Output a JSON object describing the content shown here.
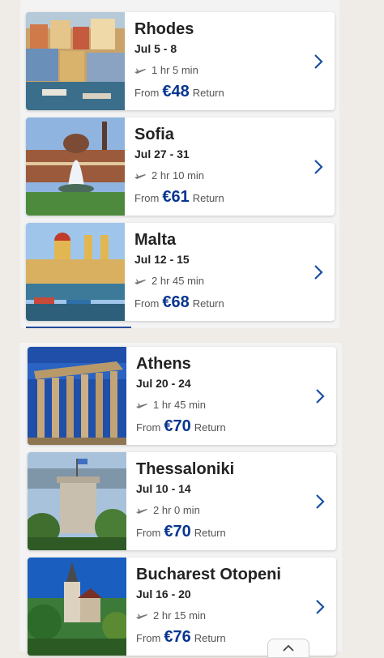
{
  "groups": [
    {
      "destinations": [
        {
          "city": "Rhodes",
          "dates": "Jul 5 - 8",
          "duration": "1 hr 5 min",
          "from_label": "From",
          "price": "€48",
          "trip_label": "Return",
          "image_icon": "harbor-photo"
        },
        {
          "city": "Sofia",
          "dates": "Jul 27 - 31",
          "duration": "2 hr 10 min",
          "from_label": "From",
          "price": "€61",
          "trip_label": "Return",
          "image_icon": "fountain-photo"
        },
        {
          "city": "Malta",
          "dates": "Jul 12 - 15",
          "duration": "2 hr 45 min",
          "from_label": "From",
          "price": "€68",
          "trip_label": "Return",
          "image_icon": "church-harbor-photo"
        }
      ]
    },
    {
      "destinations": [
        {
          "city": "Athens",
          "dates": "Jul 20 - 24",
          "duration": "1 hr 45 min",
          "from_label": "From",
          "price": "€70",
          "trip_label": "Return",
          "image_icon": "parthenon-photo"
        },
        {
          "city": "Thessaloniki",
          "dates": "Jul 10 - 14",
          "duration": "2 hr 0 min",
          "from_label": "From",
          "price": "€70",
          "trip_label": "Return",
          "image_icon": "white-tower-photo"
        },
        {
          "city": "Bucharest Otopeni",
          "dates": "Jul 16 - 20",
          "duration": "2 hr 15 min",
          "from_label": "From",
          "price": "€76",
          "trip_label": "Return",
          "image_icon": "castle-photo"
        }
      ]
    }
  ],
  "colors": {
    "price": "#073590",
    "chevron": "#1a4fa0",
    "page_bg": "#efebe6",
    "panel_bg": "#f3f3f3",
    "card_bg": "#ffffff"
  }
}
